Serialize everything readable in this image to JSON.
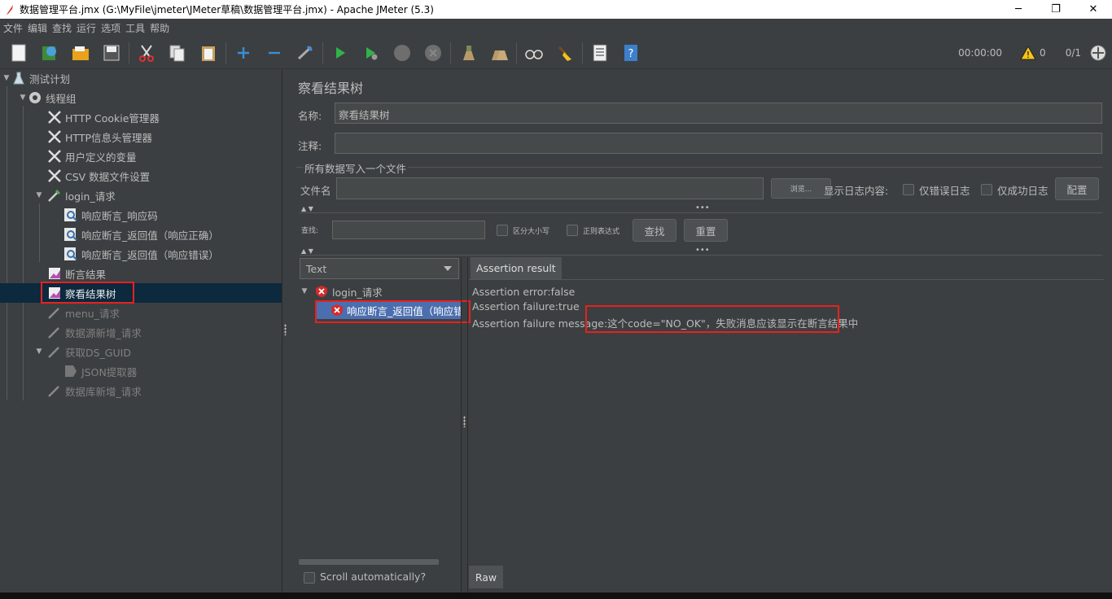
{
  "window": {
    "title": "数据管理平台.jmx (G:\\MyFile\\jmeter\\JMeter草稿\\数据管理平台.jmx) - Apache JMeter (5.3)",
    "controls": [
      "─",
      "❐",
      "✕"
    ]
  },
  "menubar": {
    "items": [
      "文件",
      "编辑",
      "查找",
      "运行",
      "选项",
      "工具",
      "帮助"
    ]
  },
  "toolbar": {
    "timer": "00:00:00",
    "warnings": "0",
    "threads": "0/1"
  },
  "tree": {
    "items": [
      {
        "label": "测试计划"
      },
      {
        "label": "线程组"
      },
      {
        "label": "HTTP Cookie管理器"
      },
      {
        "label": "HTTP信息头管理器"
      },
      {
        "label": "用户定义的变量"
      },
      {
        "label": "CSV 数据文件设置"
      },
      {
        "label": "login_请求"
      },
      {
        "label": "响应断言_响应码"
      },
      {
        "label": "响应断言_返回值（响应正确）"
      },
      {
        "label": "响应断言_返回值（响应错误）"
      },
      {
        "label": "断言结果"
      },
      {
        "label": "察看结果树"
      },
      {
        "label": "menu_请求"
      },
      {
        "label": "数据源新增_请求"
      },
      {
        "label": "获取DS_GUID"
      },
      {
        "label": "JSON提取器"
      },
      {
        "label": "数据库新增_请求"
      }
    ]
  },
  "panel": {
    "title": "察看结果树",
    "name_label": "名称:",
    "name_value": "察看结果树",
    "comment_label": "注释:",
    "comment_value": "",
    "file_section": "所有数据写入一个文件",
    "filename_label": "文件名",
    "browse": "浏览...",
    "log_label": "显示日志内容:",
    "errors_only": "仅错误日志",
    "success_only": "仅成功日志",
    "configure": "配置",
    "search_label": "查找:",
    "case_sensitive": "区分大小写",
    "regex": "正则表达式",
    "find": "查找",
    "reset": "重置",
    "renderer": "Text",
    "scroll_auto": "Scroll automatically?"
  },
  "results_tree": {
    "items": [
      {
        "label": "login_请求"
      },
      {
        "label": "响应断言_返回值（响应错"
      }
    ]
  },
  "result_tabs": {
    "active": "Assertion result",
    "bottom": "Raw"
  },
  "assertion_result": {
    "error": "Assertion error:false",
    "failure": "Assertion failure:true",
    "message_label": "Assertion failure message:",
    "message_value": "这个code=\"NO_OK\"，失败消息应该显示在断言结果中"
  }
}
